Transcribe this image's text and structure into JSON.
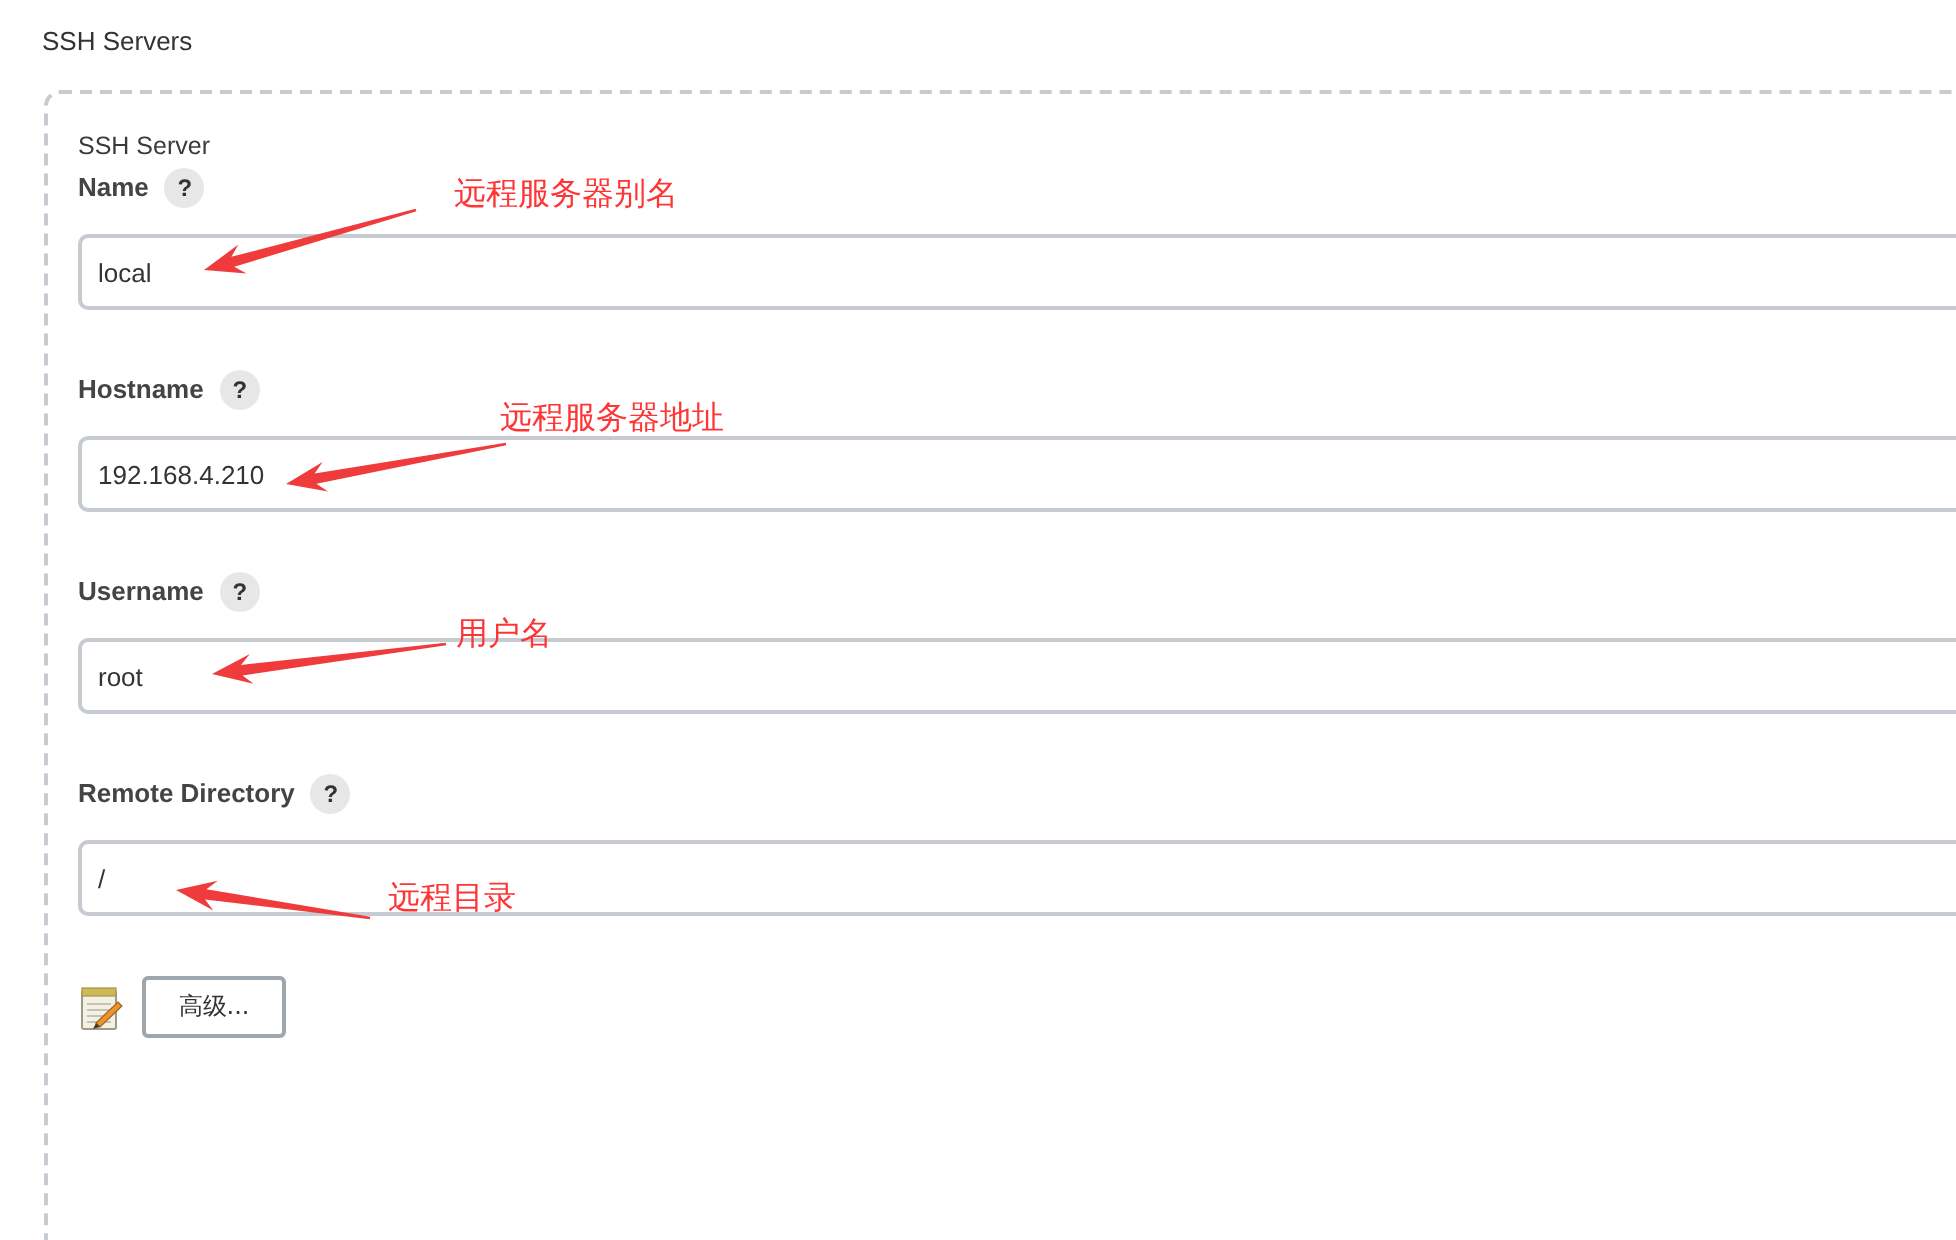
{
  "section_title": "SSH Servers",
  "server": {
    "title": "SSH Server",
    "fields": [
      {
        "label": "Name",
        "help": "?",
        "value": "local",
        "annotation": "远程服务器别名"
      },
      {
        "label": "Hostname",
        "help": "?",
        "value": "192.168.4.210",
        "annotation": "远程服务器地址"
      },
      {
        "label": "Username",
        "help": "?",
        "value": "root",
        "annotation": "用户名"
      },
      {
        "label": "Remote Directory",
        "help": "?",
        "value": "/",
        "annotation": "远程目录"
      }
    ],
    "advanced_button": "高级..."
  }
}
